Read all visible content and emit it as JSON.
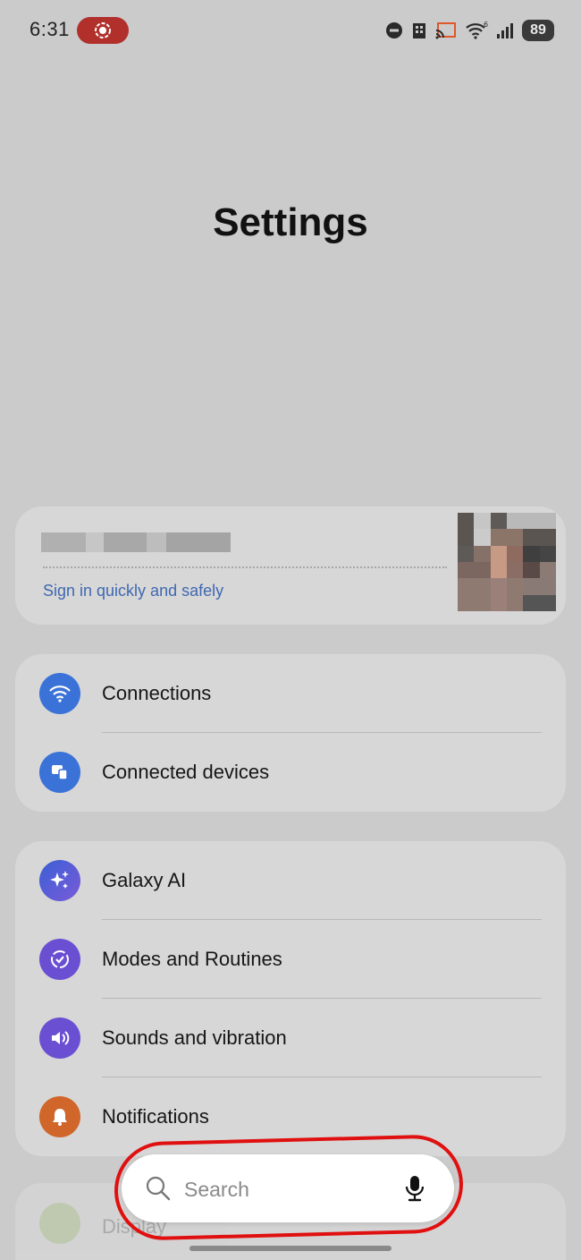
{
  "status_bar": {
    "time": "6:31",
    "battery": "89",
    "icons": [
      "screen-record-icon",
      "do-not-disturb-icon",
      "building-icon",
      "cast-icon",
      "wifi-icon",
      "signal-icon",
      "battery-icon"
    ]
  },
  "title": "Settings",
  "account": {
    "signin_text": "Sign in quickly and safely"
  },
  "groups": [
    {
      "items": [
        {
          "label": "Connections",
          "icon": "wifi-icon",
          "color": "#3a72d8"
        },
        {
          "label": "Connected devices",
          "icon": "connected-devices-icon",
          "color": "#3a72d8"
        }
      ]
    },
    {
      "items": [
        {
          "label": "Galaxy AI",
          "icon": "galaxy-ai-icon",
          "color": "#4a63d6"
        },
        {
          "label": "Modes and Routines",
          "icon": "modes-routines-icon",
          "color": "#6a4fd3"
        },
        {
          "label": "Sounds and vibration",
          "icon": "sound-icon",
          "color": "#6a4fd3"
        },
        {
          "label": "Notifications",
          "icon": "bell-icon",
          "color": "#d0662a"
        }
      ]
    }
  ],
  "partial_item": {
    "label": "Display"
  },
  "search": {
    "placeholder": "Search"
  },
  "colors": {
    "background": "#cbcbcb",
    "card": "#d7d7d7",
    "accent_link": "#3f68b0",
    "highlight": "#e01010"
  }
}
